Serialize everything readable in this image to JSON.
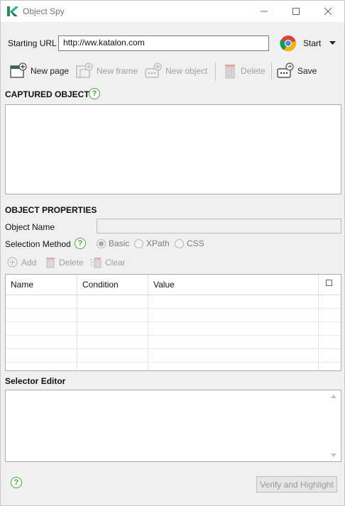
{
  "window": {
    "title": "Object Spy"
  },
  "url_bar": {
    "label": "Starting URL",
    "value": "http://ww.katalon.com",
    "start_label": "Start"
  },
  "toolbar": {
    "new_page": "New page",
    "new_frame": "New frame",
    "new_object": "New object",
    "delete": "Delete",
    "save": "Save"
  },
  "captured": {
    "heading": "CAPTURED OBJECTS"
  },
  "properties": {
    "heading": "OBJECT PROPERTIES",
    "object_name_label": "Object Name",
    "object_name_value": "",
    "selection_method_label": "Selection Method",
    "methods": [
      {
        "label": "Basic",
        "selected": true
      },
      {
        "label": "XPath",
        "selected": false
      },
      {
        "label": "CSS",
        "selected": false
      }
    ]
  },
  "attr_toolbar": {
    "add": "Add",
    "delete": "Delete",
    "clear": "Clear"
  },
  "attr_table": {
    "columns": [
      "Name",
      "Condition",
      "Value",
      "☐"
    ],
    "rows": [
      [
        "",
        "",
        "",
        ""
      ],
      [
        "",
        "",
        "",
        ""
      ],
      [
        "",
        "",
        "",
        ""
      ],
      [
        "",
        "",
        "",
        ""
      ],
      [
        "",
        "",
        "",
        ""
      ]
    ]
  },
  "selector_editor": {
    "heading": "Selector Editor",
    "value": ""
  },
  "footer": {
    "verify_button": "Verify and Highlight"
  },
  "colors": {
    "accent_green": "#47a83a",
    "disabled_text": "#a0a0a0",
    "background": "#f0f0f0"
  },
  "icons": [
    "katalon-logo-icon",
    "minimize-icon",
    "maximize-icon",
    "close-icon",
    "chrome-icon",
    "dropdown-arrow-icon",
    "new-page-icon",
    "new-frame-icon",
    "new-object-icon",
    "delete-icon",
    "save-icon",
    "help-icon",
    "add-icon",
    "clear-icon"
  ]
}
